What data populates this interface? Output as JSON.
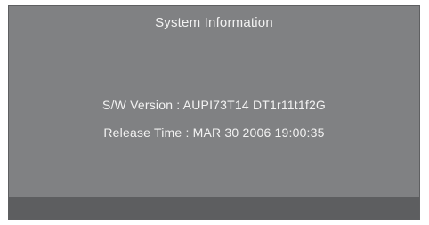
{
  "screen": {
    "title": "System Information",
    "sw_version": "S/W Version : AUPI73T14 DT1r11t1f2G",
    "release_time": "Release Time : MAR 30 2006 19:00:35"
  },
  "colors": {
    "panel_bg": "#808183",
    "footer_bg": "#5d5e60",
    "text": "#f2f2f2"
  }
}
